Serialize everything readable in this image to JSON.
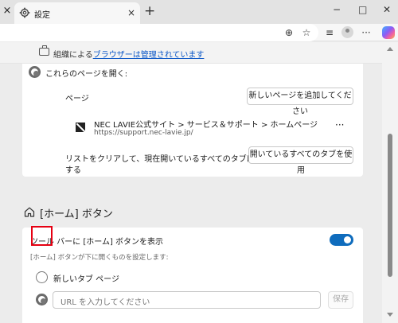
{
  "tab": {
    "title": "設定",
    "close_left": "×",
    "close": "×",
    "new_tab": "+"
  },
  "window": {
    "minimize": "−",
    "maximize": "□",
    "close": "✕"
  },
  "toolbar": {
    "zoom_icon": "⊕",
    "star_icon": "☆",
    "favorites_icon": "≡",
    "more_icon": "···"
  },
  "managed": {
    "prefix": "組織による",
    "link": "ブラウザーは管理されています"
  },
  "startup": {
    "open_pages_label": "これらのページを開く:",
    "pages_label": "ページ",
    "add_page_button": "新しいページを追加してください",
    "site_title": "NEC LAVIE公式サイト > サービス＆サポート > ホームページ",
    "site_url": "https://support.nec-lavie.jp/",
    "site_more": "···",
    "clear_text_line1": "リストをクリアして、現在開いているすべてのタブに設定",
    "clear_text_line2": "する",
    "use_open_tabs_button": "開いているすべてのタブを使用"
  },
  "home": {
    "section_title": "[ホーム] ボタン",
    "show_on_toolbar_label": "ツール バーに [ホーム] ボタンを表示",
    "toggle_on": true,
    "description": "[ホーム] ボタンが下に開くものを設定します:",
    "new_tab_option": "新しいタブ ページ",
    "url_placeholder": "URL を入力してください",
    "save_button": "保存"
  },
  "colors": {
    "accent": "#0f6cbd",
    "highlight": "#e60012",
    "link": "#0b57c7"
  }
}
